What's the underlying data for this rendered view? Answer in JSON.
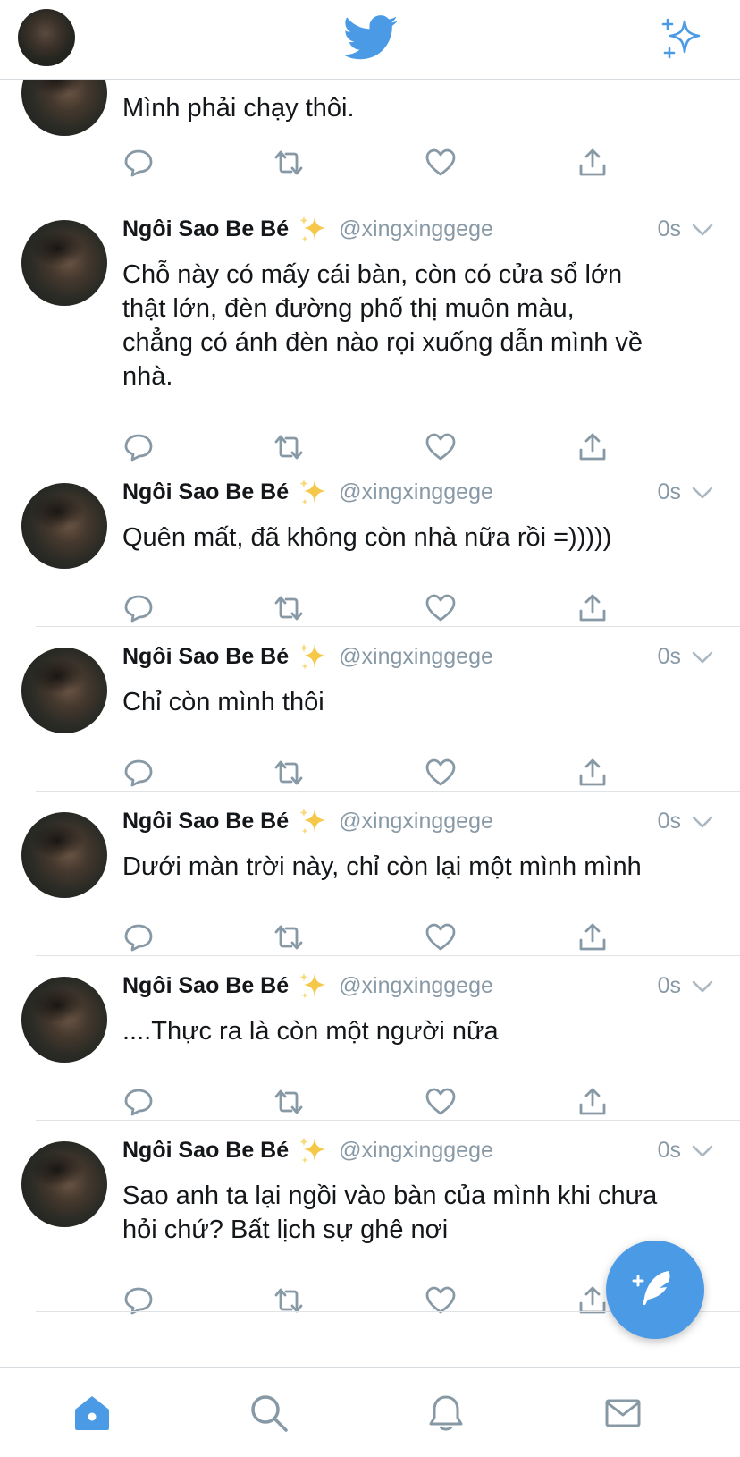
{
  "colors": {
    "accent": "#4a9ae5",
    "muted": "#8899a6",
    "text": "#14171a"
  },
  "topbar": {
    "avatar_icon": "user-avatar",
    "logo_icon": "twitter-bird",
    "sparkle_icon": "sparkle-icon"
  },
  "first_tweet": {
    "text": "Mình phải chạy thôi."
  },
  "tweets": [
    {
      "name": "Ngôi Sao Be Bé",
      "handle": "@xingxinggege",
      "time": "0s",
      "lines": [
        "Chỗ này có mấy cái bàn, còn có cửa sổ lớn",
        "thật lớn, đèn đường phố thị muôn màu,",
        "chẳng có ánh đèn nào rọi xuống dẫn mình về",
        "nhà."
      ]
    },
    {
      "name": "Ngôi Sao Be Bé",
      "handle": "@xingxinggege",
      "time": "0s",
      "lines": [
        "Quên mất, đã không còn nhà nữa rồi =)))))"
      ]
    },
    {
      "name": "Ngôi Sao Be Bé",
      "handle": "@xingxinggege",
      "time": "0s",
      "lines": [
        "Chỉ còn mình thôi"
      ]
    },
    {
      "name": "Ngôi Sao Be Bé",
      "handle": "@xingxinggege",
      "time": "0s",
      "lines": [
        "Dưới màn trời này, chỉ còn lại một mình mình"
      ]
    },
    {
      "name": "Ngôi Sao Be Bé",
      "handle": "@xingxinggege",
      "time": "0s",
      "lines": [
        "....Thực ra là còn một người nữa"
      ]
    },
    {
      "name": "Ngôi Sao Be Bé",
      "handle": "@xingxinggege",
      "time": "0s",
      "lines": [
        "Sao anh ta lại ngồi vào bàn của mình khi chưa",
        "hỏi chứ? Bất lịch sự ghê nơi"
      ]
    }
  ],
  "fab": {
    "icon": "compose-feather-icon"
  },
  "bottom_nav": [
    {
      "name": "home",
      "icon": "home-icon",
      "active": true
    },
    {
      "name": "search",
      "icon": "search-icon",
      "active": false
    },
    {
      "name": "notifications",
      "icon": "bell-icon",
      "active": false
    },
    {
      "name": "messages",
      "icon": "mail-icon",
      "active": false
    }
  ]
}
